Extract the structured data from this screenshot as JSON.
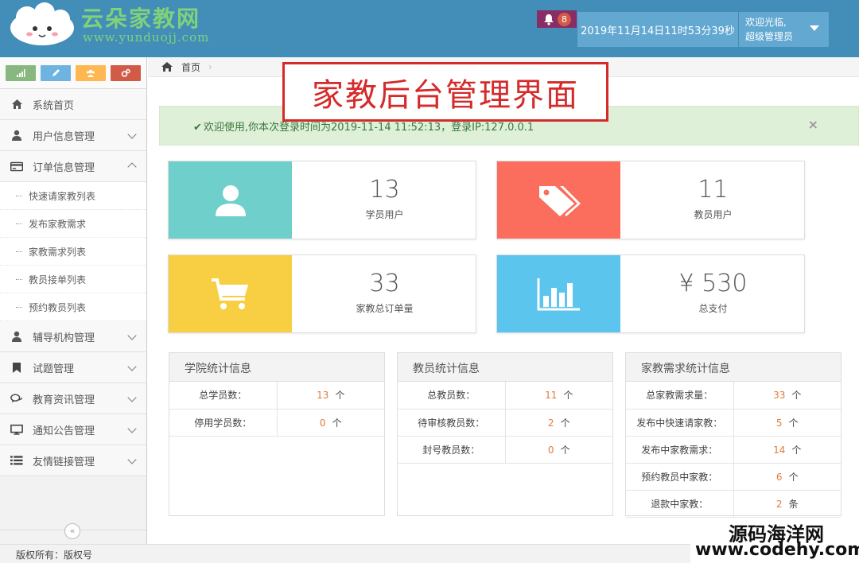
{
  "header": {
    "logo": {
      "brand": "云朵家教网",
      "url": "www.yunduojj.com"
    },
    "notifications": {
      "count": "8"
    },
    "clock": "2019年11月14日11时53分39秒",
    "user": {
      "greeting": "欢迎光临,",
      "role": "超级管理员"
    }
  },
  "sidebar": {
    "shortcuts": [
      {
        "icon": "signal-icon",
        "color": "#87b87f"
      },
      {
        "icon": "pencil-icon",
        "color": "#6fb3e0"
      },
      {
        "icon": "users-icon",
        "color": "#ffb752"
      },
      {
        "icon": "cogs-icon",
        "color": "#d15b47"
      }
    ],
    "items": [
      {
        "label": "系统首页",
        "icon": "home-icon"
      },
      {
        "label": "用户信息管理",
        "icon": "user-icon"
      },
      {
        "label": "订单信息管理",
        "icon": "credit-card-icon",
        "children": [
          "快速请家教列表",
          "发布家教需求",
          "家教需求列表",
          "教员接单列表",
          "预约教员列表"
        ]
      },
      {
        "label": "辅导机构管理",
        "icon": "user-icon"
      },
      {
        "label": "试题管理",
        "icon": "bookmark-icon"
      },
      {
        "label": "教育资讯管理",
        "icon": "comments-icon"
      },
      {
        "label": "通知公告管理",
        "icon": "desktop-icon"
      },
      {
        "label": "友情链接管理",
        "icon": "list-icon"
      }
    ],
    "collapse": "«"
  },
  "breadcrumb": {
    "home": "首页"
  },
  "banner": "家教后台管理界面",
  "alert": {
    "text": "欢迎使用,你本次登录时间为2019-11-14 11:52:13，登录IP:127.0.0.1",
    "close": "×"
  },
  "stats": [
    {
      "value": "13",
      "label": "学员用户",
      "icon": "user-icon",
      "color": "#6fcfcb"
    },
    {
      "value": "11",
      "label": "教员用户",
      "icon": "tags-icon",
      "color": "#fb6e5e"
    },
    {
      "value": "33",
      "label": "家教总订单量",
      "icon": "shopping-cart-icon",
      "color": "#f8cf42"
    },
    {
      "value": "¥ 530",
      "label": "总支付",
      "icon": "bar-chart-icon",
      "color": "#5bc5ee"
    }
  ],
  "panels": [
    {
      "title": "学院统计信息",
      "rows": [
        {
          "k": "总学员数：",
          "n": "13",
          "u": "个"
        },
        {
          "k": "停用学员数：",
          "n": "0",
          "u": "个"
        }
      ]
    },
    {
      "title": "教员统计信息",
      "rows": [
        {
          "k": "总教员数：",
          "n": "11",
          "u": "个"
        },
        {
          "k": "待审核教员数：",
          "n": "2",
          "u": "个"
        },
        {
          "k": "封号教员数：",
          "n": "0",
          "u": "个"
        }
      ]
    },
    {
      "title": "家教需求统计信息",
      "rows": [
        {
          "k": "总家教需求量：",
          "n": "33",
          "u": "个"
        },
        {
          "k": "发布中快速请家教：",
          "n": "5",
          "u": "个"
        },
        {
          "k": "发布中家教需求：",
          "n": "14",
          "u": "个"
        },
        {
          "k": "预约教员中家教：",
          "n": "6",
          "u": "个"
        },
        {
          "k": "退款中家教：",
          "n": "2",
          "u": "条"
        }
      ]
    }
  ],
  "footer": "版权所有：版权号",
  "watermark": {
    "line1": "源码海洋网",
    "line2": "www.codehy.com"
  }
}
